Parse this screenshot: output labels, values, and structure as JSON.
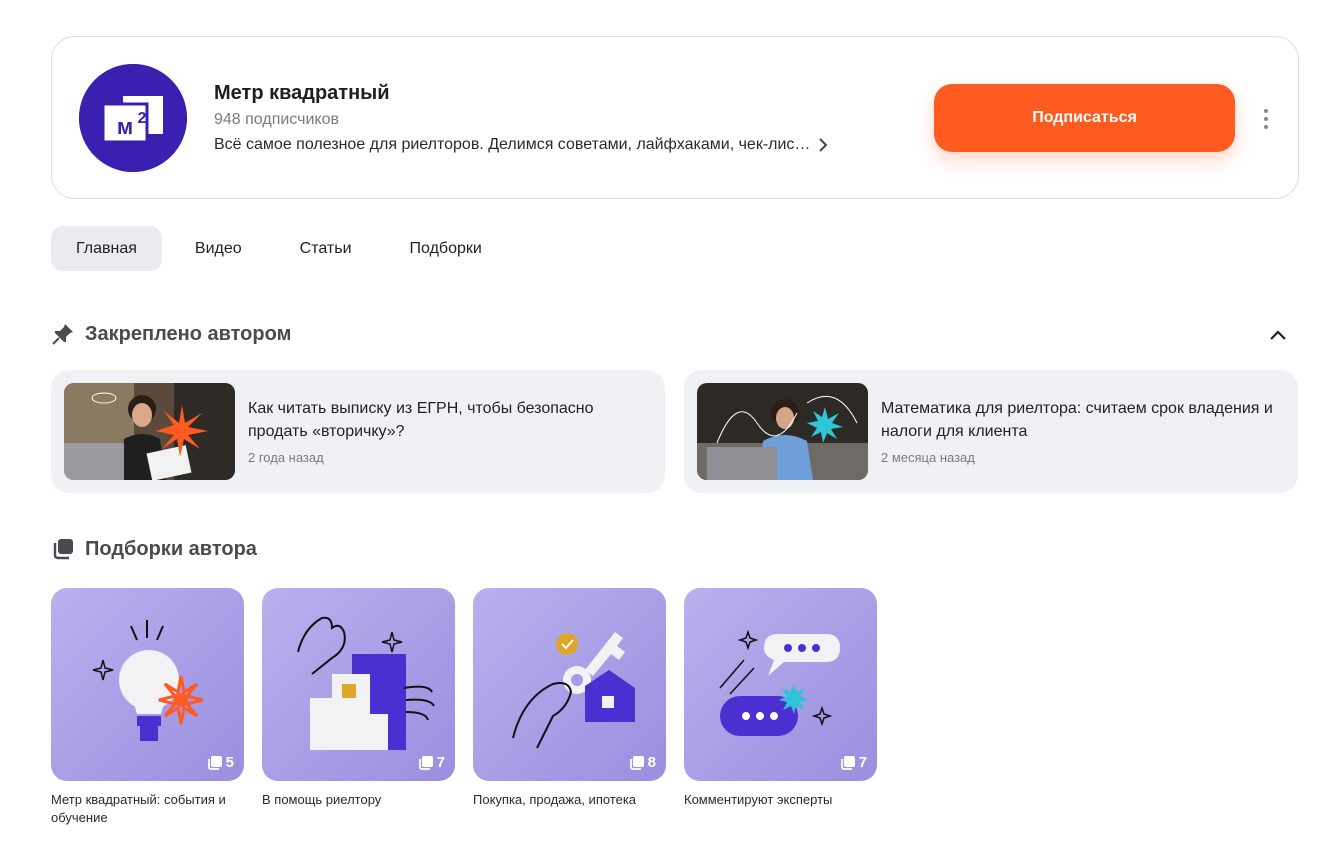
{
  "channel": {
    "title": "Метр квадратный",
    "subscribers": "948 подписчиков",
    "description": "Всё самое полезное для риелторов. Делимся советами, лайфхаками, чек-лис…",
    "avatar_text": "м²",
    "subscribe_label": "Подписаться",
    "avatar_color": "#3a1fb0",
    "accent_color": "#ff5a1f"
  },
  "tabs": [
    {
      "label": "Главная",
      "active": true
    },
    {
      "label": "Видео",
      "active": false
    },
    {
      "label": "Статьи",
      "active": false
    },
    {
      "label": "Подборки",
      "active": false
    }
  ],
  "pinned": {
    "heading": "Закреплено автором",
    "items": [
      {
        "title": "Как читать выписку из ЕГРН, чтобы безопасно продать «вторичку»?",
        "date": "2 года назад"
      },
      {
        "title": "Математика для риелтора: считаем срок владения и налоги для клиента",
        "date": "2 месяца назад"
      }
    ]
  },
  "collections": {
    "heading": "Подборки автора",
    "items": [
      {
        "label": "Метр квадратный: события и обучение",
        "count": "5",
        "icon": "lightbulb-illustration"
      },
      {
        "label": "В помощь риелтору",
        "count": "7",
        "icon": "ok-hand-building-illustration"
      },
      {
        "label": "Покупка, продажа, ипотека",
        "count": "8",
        "icon": "key-house-illustration"
      },
      {
        "label": "Комментируют эксперты",
        "count": "7",
        "icon": "chat-bubbles-illustration"
      }
    ]
  }
}
